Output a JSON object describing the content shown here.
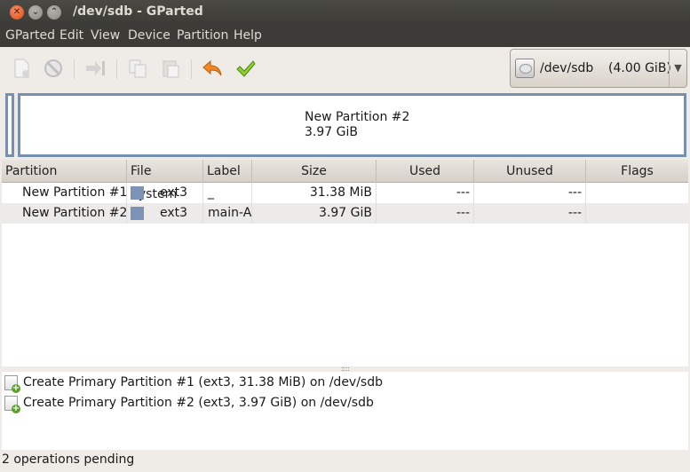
{
  "window": {
    "title": "/dev/sdb - GParted"
  },
  "menu": [
    "GParted",
    "Edit",
    "View",
    "Device",
    "Partition",
    "Help"
  ],
  "toolbar": {
    "icons": [
      "new-icon",
      "delete-icon",
      "resize-move-icon",
      "copy-icon",
      "paste-icon",
      "undo-icon",
      "apply-icon"
    ]
  },
  "device": {
    "name": "/dev/sdb",
    "size": "(4.00 GiB)"
  },
  "disk_visual": {
    "partition_name": "New Partition #2",
    "partition_size": "3.97 GiB"
  },
  "table": {
    "columns": [
      "Partition",
      "File System",
      "Label",
      "Size",
      "Used",
      "Unused",
      "Flags"
    ],
    "rows": [
      {
        "partition": "New Partition #1",
        "filesystem": "ext3",
        "label": "_",
        "size": "31.38 MiB",
        "used": "---",
        "unused": "---",
        "flags": ""
      },
      {
        "partition": "New Partition #2",
        "filesystem": "ext3",
        "label": "main-A",
        "size": "3.97 GiB",
        "used": "---",
        "unused": "---",
        "flags": ""
      }
    ]
  },
  "operations": [
    "Create Primary Partition #1 (ext3, 31.38 MiB) on /dev/sdb",
    "Create Primary Partition #2 (ext3, 3.97 GiB) on /dev/sdb"
  ],
  "status": "2 operations pending",
  "colors": {
    "ext3": "#7c93b7",
    "menubar": "#3c3b37",
    "close_button": "#df4a16",
    "partition_border": "#7890b0"
  }
}
